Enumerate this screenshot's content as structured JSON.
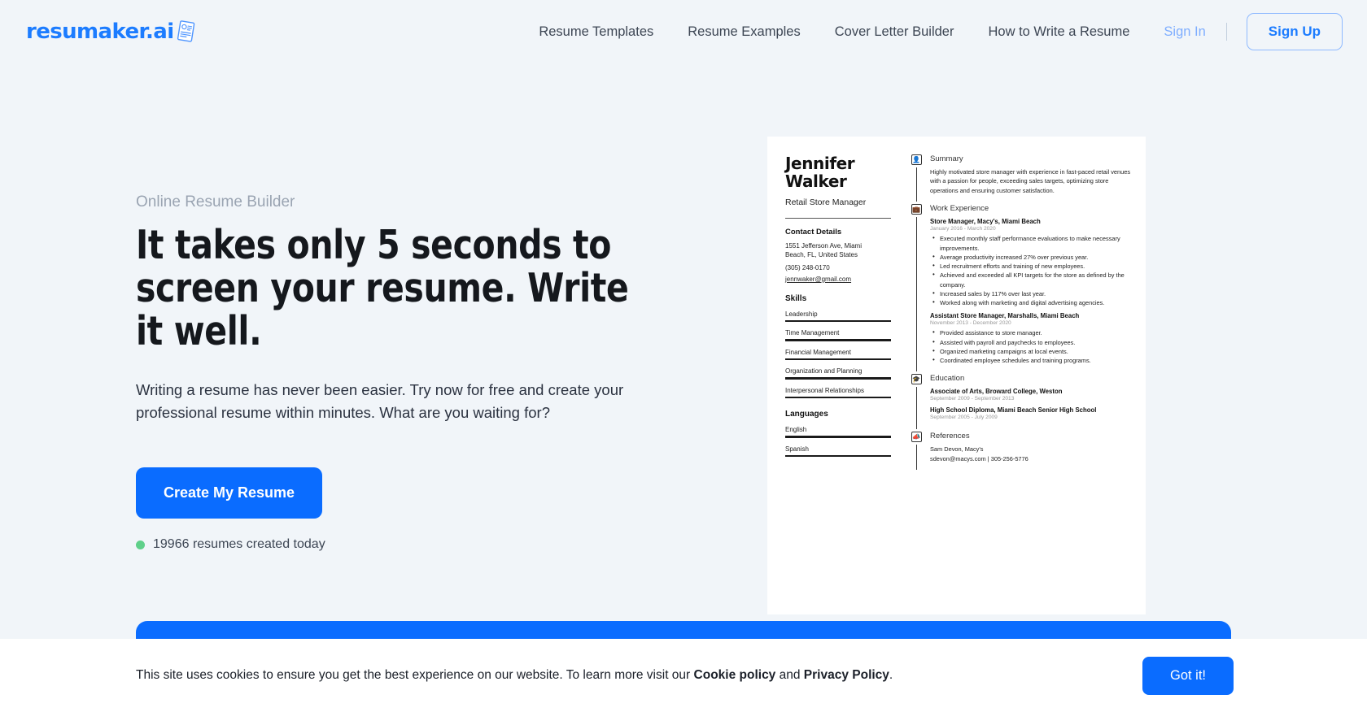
{
  "header": {
    "logo_text": "resumaker.ai",
    "logo_icon": "resume-document-icon",
    "nav": [
      {
        "label": "Resume Templates"
      },
      {
        "label": "Resume Examples"
      },
      {
        "label": "Cover Letter Builder"
      },
      {
        "label": "How to Write a Resume"
      }
    ],
    "sign_in": "Sign In",
    "sign_up": "Sign Up"
  },
  "hero": {
    "eyebrow": "Online Resume Builder",
    "headline": "It takes only 5 seconds to screen your resume. Write it well.",
    "subtext": "Writing a resume has never been easier. Try now for free and create your professional resume within minutes. What are you waiting for?",
    "cta": "Create My Resume",
    "counter": "19966 resumes created today",
    "counter_dot_color": "#5fd08a"
  },
  "resume": {
    "name": "Jennifer Walker",
    "name_line1": "Jennifer",
    "name_line2": "Walker",
    "job_title": "Retail Store Manager",
    "contact_heading": "Contact Details",
    "address_line1": "1551 Jefferson Ave, Miami",
    "address_line2": "Beach, FL, United States",
    "phone": "(305) 248-0170",
    "email": "jennwaker@gmail.com",
    "skills_heading": "Skills",
    "skills": [
      "Leadership",
      "Time Management",
      "Financial Management",
      "Organization and Planning",
      "Interpersonal Relationships"
    ],
    "languages_heading": "Languages",
    "languages": [
      "English",
      "Spanish"
    ],
    "summary_heading": "Summary",
    "summary_icon": "person-icon",
    "summary_text": "Highly motivated store manager with experience in fast-paced retail venues with a passion for people, exceeding sales targets, optimizing store operations and ensuring customer satisfaction.",
    "experience_heading": "Work Experience",
    "experience_icon": "briefcase-icon",
    "jobs": [
      {
        "title": "Store Manager, Macy's, Miami Beach",
        "dates": "January 2016 - March 2020",
        "bullets": [
          "Executed monthly staff performance evaluations to make necessary improvements.",
          "Average productivity increased 27% over previous year.",
          "Led recruitment efforts and training of new employees.",
          "Achieved and exceeded all KPI targets for the store as defined by the company.",
          "Increased sales by 117% over last year.",
          "Worked along with marketing and digital advertising agencies."
        ]
      },
      {
        "title": "Assistant Store Manager, Marshalls, Miami Beach",
        "dates": "November 2013 - December 2020",
        "bullets": [
          "Provided assistance to store manager.",
          "Assisted with payroll and paychecks to employees.",
          "Organized marketing campaigns at local events.",
          "Coordinated employee schedules and training programs."
        ]
      }
    ],
    "education_heading": "Education",
    "education_icon": "graduation-cap-icon",
    "education": [
      {
        "title": "Associate of Arts, Broward College, Weston",
        "dates": "September 2009 - September 2013"
      },
      {
        "title": "High School Diploma, Miami Beach Senior High School",
        "dates": "September 2005 - July 2009"
      }
    ],
    "references_heading": "References",
    "references_icon": "megaphone-icon",
    "reference_name": "Sam Devon, Macy's",
    "reference_contact": "sdevon@macys.com | 305-256-5776"
  },
  "cookie": {
    "text_part1": "This site uses cookies to ensure you get the best experience on our website. To learn more visit our ",
    "link1": "Cookie policy",
    "text_mid": " and ",
    "link2": "Privacy Policy",
    "text_end": ".",
    "accept": "Got it!"
  },
  "colors": {
    "brand_blue": "#0a6cff",
    "logo_blue": "#1c7cff",
    "page_bg": "#f1f5f9",
    "green": "#5fd08a"
  }
}
